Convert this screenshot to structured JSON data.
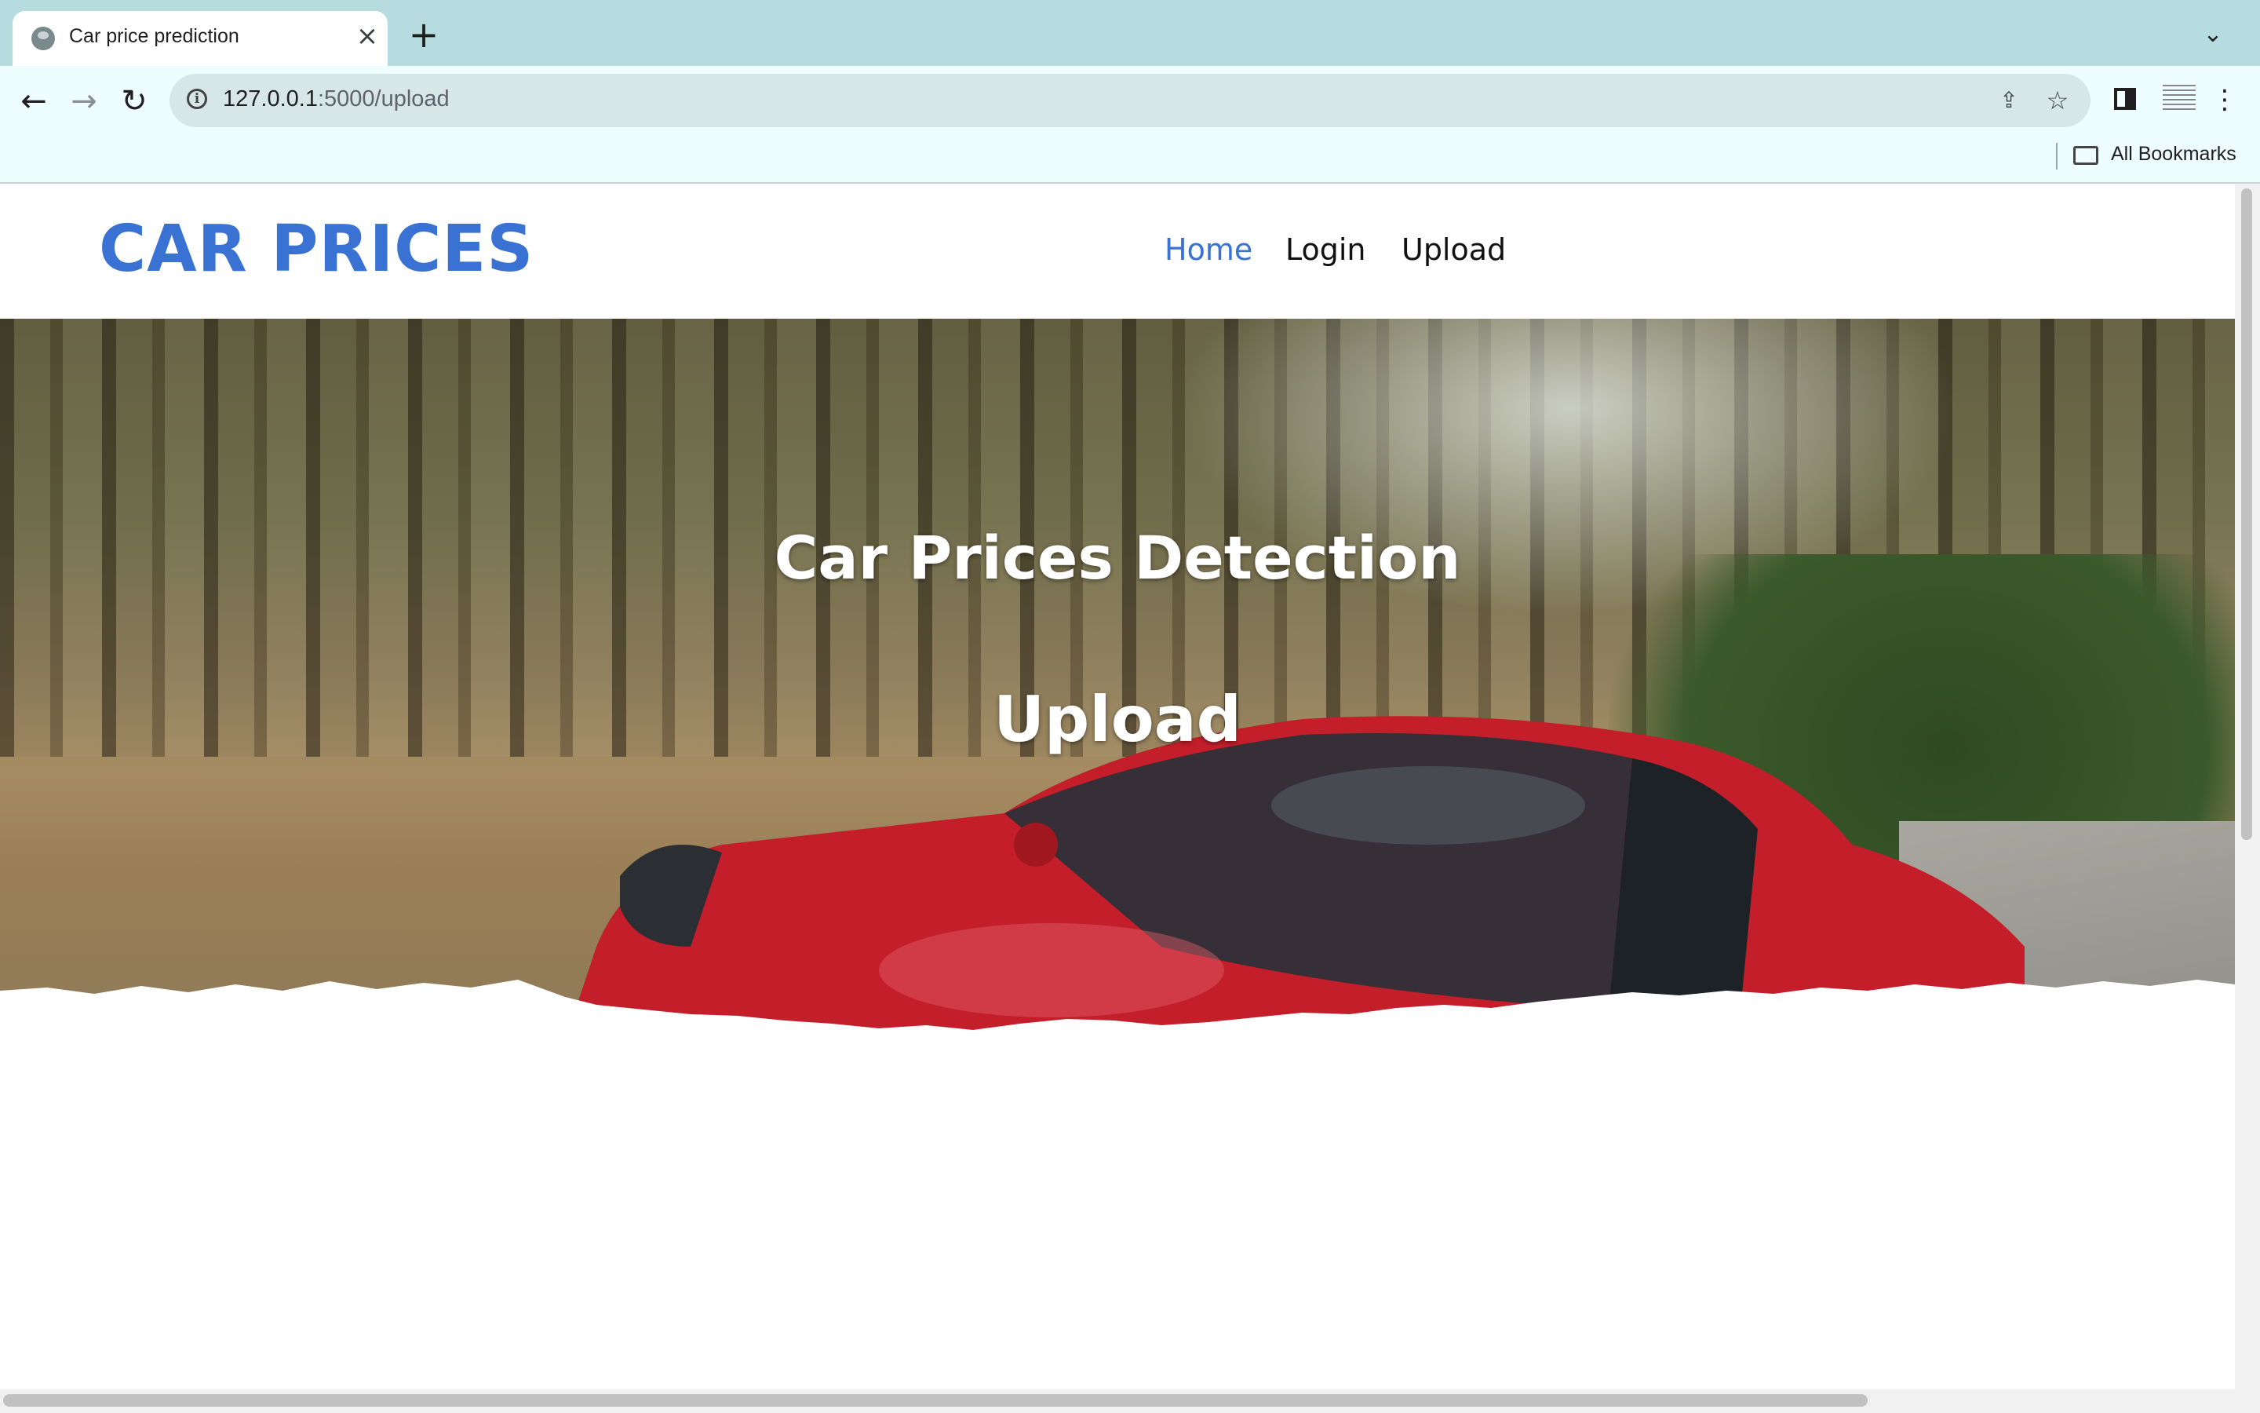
{
  "browser": {
    "tab_title": "Car price prediction",
    "url_host": "127.0.0.1",
    "url_path": ":5000/upload",
    "bookmarks_label": "All Bookmarks"
  },
  "site": {
    "logo": "CAR PRICES",
    "nav": [
      {
        "label": "Home",
        "active": true
      },
      {
        "label": "Login",
        "active": false
      },
      {
        "label": "Upload",
        "active": false
      }
    ],
    "hero_title": "Car Prices Detection",
    "hero_subtitle": "Upload"
  },
  "colors": {
    "accent": "#3a72d4",
    "tabstrip": "#b6dcdf",
    "toolbar": "#eefdfe",
    "car_red": "#c41e2a"
  },
  "icons": {
    "back": "arrow-left",
    "forward": "arrow-right",
    "reload": "reload",
    "info": "info-circle",
    "share": "share",
    "bookmark": "star",
    "side_panel": "side-panel",
    "profile": "profile",
    "menu": "kebab-menu",
    "folder": "folder",
    "tab_search": "chevron-down"
  }
}
